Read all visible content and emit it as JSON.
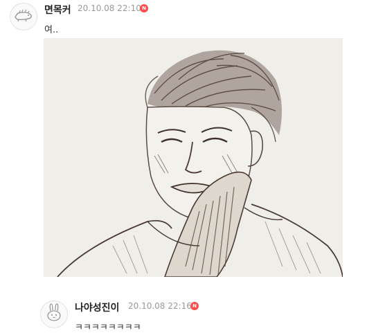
{
  "comments": [
    {
      "author": "면목커",
      "timestamp": "20.10.08 22:10",
      "badge": "N",
      "text": "여..",
      "avatar_icon": "lizard-doodle-icon",
      "image": {
        "icon": "sketch-portrait-icon"
      }
    },
    {
      "author": "나야성진이",
      "timestamp": "20.10.08 22:16",
      "badge": "N",
      "text": "ㅋㅋㅋㅋㅋㅋㅋㅋ",
      "avatar_icon": "rabbit-doodle-icon"
    }
  ],
  "colors": {
    "badge": "#ff4c4c",
    "timestamp": "#999999",
    "image_bg": "#efeee9",
    "sketch_ink": "#5a4a40"
  }
}
